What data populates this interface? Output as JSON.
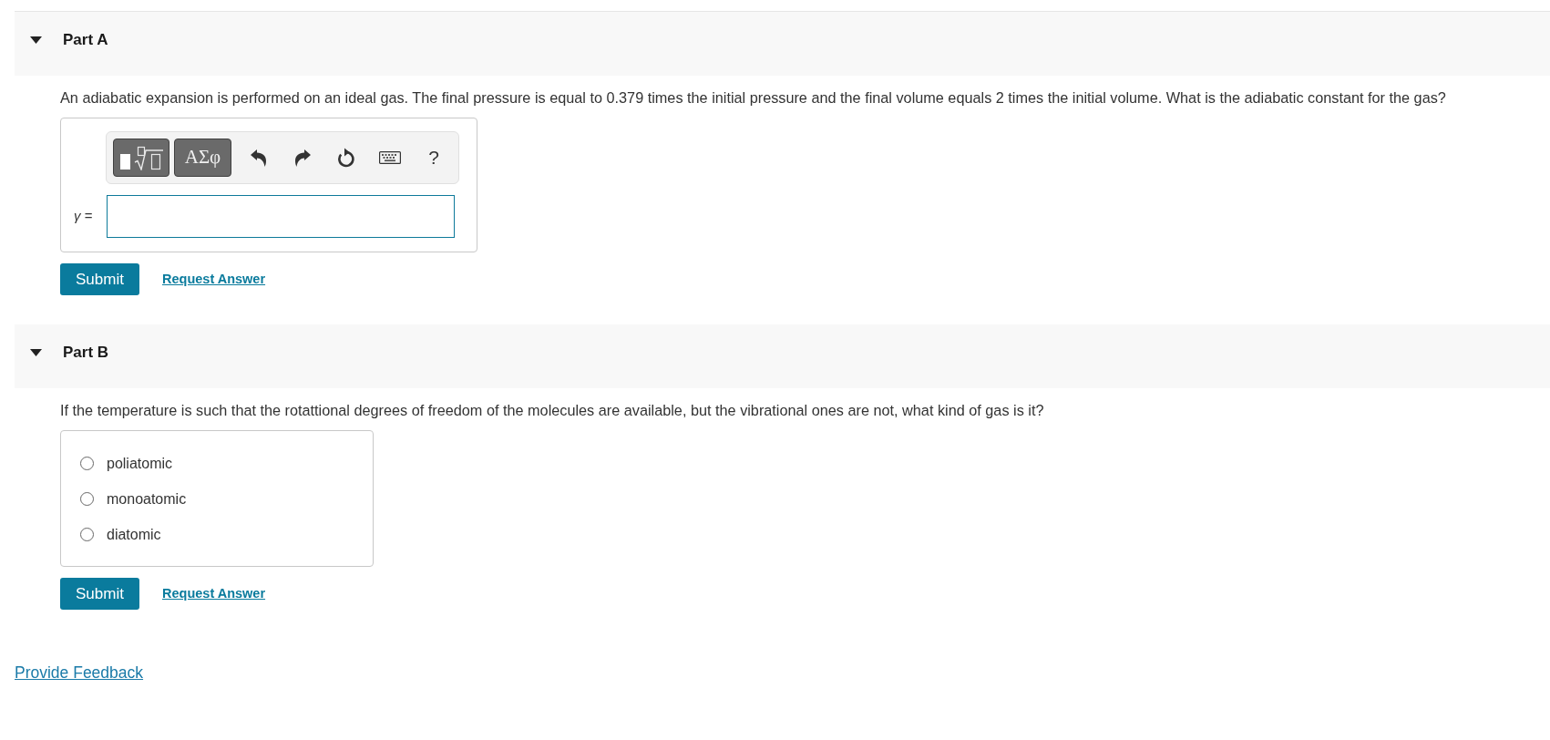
{
  "parts": [
    {
      "title": "Part A",
      "expanded": true,
      "kind": "math_input",
      "question": "An adiabatic expansion is performed on an ideal gas. The final pressure is equal to 0.379 times the initial pressure and the final volume equals 2 times the initial volume. What is the adiabatic constant for the gas?",
      "toolbar": {
        "symbols_button": "ΑΣφ",
        "help_button": "?"
      },
      "answer_label": "*γ* =",
      "submit": "Submit",
      "request_answer": "Request Answer"
    },
    {
      "title": "Part B",
      "expanded": true,
      "kind": "multiple_choice",
      "question": "If the temperature is such that the rotattional degrees of freedom of the molecules are available, but the vibrational ones are not, what kind of gas is it?",
      "options": [
        {
          "label": "poliatomic",
          "selected": false
        },
        {
          "label": "monoatomic",
          "selected": false
        },
        {
          "label": "diatomic",
          "selected": false
        }
      ],
      "submit": "Submit",
      "request_answer": "Request Answer"
    }
  ],
  "feedback_link": "Provide Feedback"
}
